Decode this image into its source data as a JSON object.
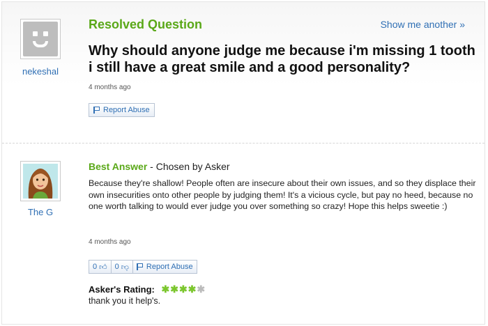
{
  "question": {
    "asker_name": "nekeshal",
    "status_label": "Resolved Question",
    "show_another": "Show me another »",
    "title": "Why should anyone judge me because i'm missing 1 tooth i still have a great smile and a good personality?",
    "time_ago": "4 months ago",
    "report_abuse": "Report Abuse"
  },
  "answer": {
    "answerer_name": "The G",
    "best_answer_label": "Best Answer",
    "chosen_by": " - Chosen by Asker",
    "text": "Because they're shallow! People often are insecure about their own issues, and so they displace their own insecurities onto other people by judging them! It's a vicious cycle, but pay no heed, because no one worth talking to would ever judge you over something so crazy! Hope this helps sweetie :)",
    "time_ago": "4 months ago",
    "thumbs_up_count": "0",
    "thumbs_down_count": "0",
    "report_abuse": "Report Abuse",
    "rating_label": "Asker's Rating:",
    "rating_value": 4,
    "rating_max": 5,
    "rating_comment": "thank you it help's."
  },
  "colors": {
    "accent_green": "#5aa818",
    "link_blue": "#2f6fb4",
    "star_green": "#7bc62d"
  },
  "icons": {
    "default_avatar": "smiley-face-icon",
    "report_flag": "flag-icon",
    "thumbs_up": "thumbs-up-icon",
    "thumbs_down": "thumbs-down-icon",
    "star": "star-icon"
  }
}
